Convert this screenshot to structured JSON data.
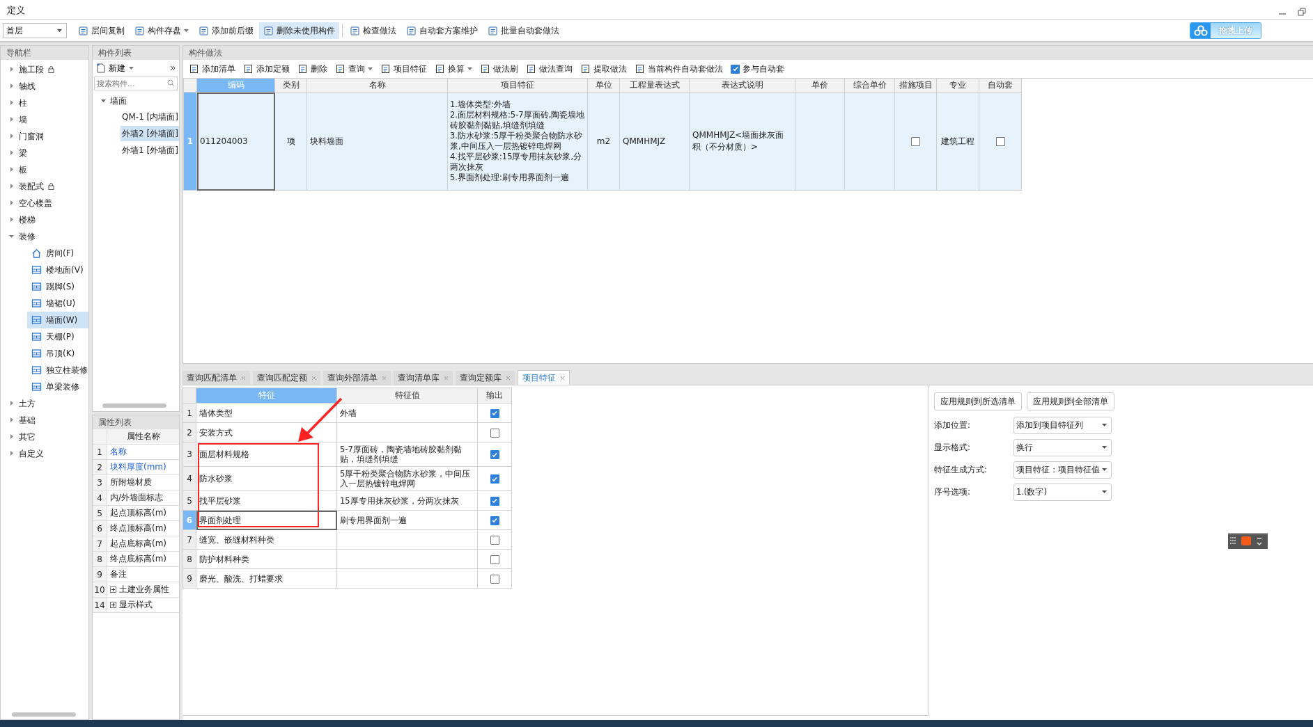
{
  "window": {
    "title": "定义"
  },
  "toolbar": {
    "floor_select": {
      "value": "首层"
    },
    "buttons": [
      {
        "label": "层间复制",
        "dropdown": false,
        "active": false
      },
      {
        "label": "构件存盘",
        "dropdown": true,
        "active": false
      },
      {
        "label": "添加前后缀",
        "dropdown": false,
        "active": false
      },
      {
        "label": "删除未使用构件",
        "dropdown": false,
        "active": true
      },
      {
        "label": "检查做法",
        "dropdown": false,
        "active": false
      },
      {
        "label": "自动套方案维护",
        "dropdown": false,
        "active": false
      },
      {
        "label": "批量自动套做法",
        "dropdown": false,
        "active": false
      }
    ],
    "upload_button": {
      "label": "拖拽上传"
    }
  },
  "nav": {
    "title": "导航栏",
    "items": [
      {
        "label": "施工段",
        "locked": true,
        "expanded": false
      },
      {
        "label": "轴线",
        "locked": false,
        "expanded": false
      },
      {
        "label": "柱",
        "locked": false,
        "expanded": false
      },
      {
        "label": "墙",
        "locked": false,
        "expanded": false
      },
      {
        "label": "门窗洞",
        "locked": false,
        "expanded": false
      },
      {
        "label": "梁",
        "locked": false,
        "expanded": false
      },
      {
        "label": "板",
        "locked": false,
        "expanded": false
      },
      {
        "label": "装配式",
        "locked": true,
        "expanded": false
      },
      {
        "label": "空心楼盖",
        "locked": false,
        "expanded": false
      },
      {
        "label": "楼梯",
        "locked": false,
        "expanded": false
      },
      {
        "label": "装修",
        "locked": false,
        "expanded": true,
        "children": [
          {
            "label": "房间(F)",
            "selected": false
          },
          {
            "label": "楼地面(V)",
            "selected": false
          },
          {
            "label": "踢脚(S)",
            "selected": false
          },
          {
            "label": "墙裙(U)",
            "selected": false
          },
          {
            "label": "墙面(W)",
            "selected": true
          },
          {
            "label": "天棚(P)",
            "selected": false
          },
          {
            "label": "吊顶(K)",
            "selected": false
          },
          {
            "label": "独立柱装修",
            "selected": false
          },
          {
            "label": "单梁装修",
            "selected": false
          }
        ]
      },
      {
        "label": "土方",
        "locked": false,
        "expanded": false
      },
      {
        "label": "基础",
        "locked": false,
        "expanded": false
      },
      {
        "label": "其它",
        "locked": false,
        "expanded": false
      },
      {
        "label": "自定义",
        "locked": false,
        "expanded": false
      }
    ]
  },
  "component_list": {
    "title": "构件列表",
    "new_button": "新建",
    "search": {
      "placeholder": "搜索构件..."
    },
    "tree": [
      {
        "label": "墙面",
        "expanded": true,
        "children": [
          {
            "label": "QM-1 [内墙面]",
            "selected": false
          },
          {
            "label": "外墙2 [外墙面]",
            "selected": true
          },
          {
            "label": "外墙1 [外墙面]",
            "selected": false
          }
        ]
      }
    ]
  },
  "properties": {
    "title": "属性列表",
    "column": "属性名称",
    "rows": [
      {
        "index": "1",
        "label": "名称",
        "public": true,
        "expandable": false
      },
      {
        "index": "2",
        "label": "块料厚度(mm)",
        "public": true,
        "expandable": false
      },
      {
        "index": "3",
        "label": "所附墙材质",
        "public": false,
        "expandable": false
      },
      {
        "index": "4",
        "label": "内/外墙面标志",
        "public": false,
        "expandable": false
      },
      {
        "index": "5",
        "label": "起点顶标高(m)",
        "public": false,
        "expandable": false
      },
      {
        "index": "6",
        "label": "终点顶标高(m)",
        "public": false,
        "expandable": false
      },
      {
        "index": "7",
        "label": "起点底标高(m)",
        "public": false,
        "expandable": false
      },
      {
        "index": "8",
        "label": "终点底标高(m)",
        "public": false,
        "expandable": false
      },
      {
        "index": "9",
        "label": "备注",
        "public": false,
        "expandable": false
      },
      {
        "index": "10",
        "label": "土建业务属性",
        "public": false,
        "expandable": true
      },
      {
        "index": "14",
        "label": "显示样式",
        "public": false,
        "expandable": true
      }
    ]
  },
  "methods": {
    "title": "构件做法",
    "toolbar": [
      {
        "kind": "button",
        "label": "添加清单",
        "dropdown": false
      },
      {
        "kind": "button",
        "label": "添加定额",
        "dropdown": false
      },
      {
        "kind": "button",
        "label": "删除",
        "dropdown": false
      },
      {
        "kind": "button",
        "label": "查询",
        "dropdown": true
      },
      {
        "kind": "button",
        "label": "项目特征",
        "dropdown": false
      },
      {
        "kind": "button",
        "label": "换算",
        "dropdown": true
      },
      {
        "kind": "button",
        "label": "做法刷",
        "dropdown": false
      },
      {
        "kind": "button",
        "label": "做法查询",
        "dropdown": false
      },
      {
        "kind": "button",
        "label": "提取做法",
        "dropdown": false
      },
      {
        "kind": "button",
        "label": "当前构件自动套做法",
        "dropdown": false
      },
      {
        "kind": "checkbox",
        "label": "参与自动套",
        "checked": true
      }
    ],
    "table": {
      "columns": [
        {
          "label": "编码",
          "selected": true
        },
        {
          "label": "类别",
          "selected": false
        },
        {
          "label": "名称",
          "selected": false
        },
        {
          "label": "项目特征",
          "selected": false
        },
        {
          "label": "单位",
          "selected": false
        },
        {
          "label": "工程量表达式",
          "selected": false
        },
        {
          "label": "表达式说明",
          "selected": false
        },
        {
          "label": "单价",
          "selected": false
        },
        {
          "label": "综合单价",
          "selected": false
        },
        {
          "label": "措施项目",
          "selected": false
        },
        {
          "label": "专业",
          "selected": false
        },
        {
          "label": "自动套",
          "selected": false
        }
      ],
      "rows": [
        {
          "index": "1",
          "selected": true,
          "code": "011204003",
          "type": "项",
          "name": "块料墙面",
          "features": [
            "1.墙体类型:外墙",
            "2.面层材料规格:5-7厚面砖,陶瓷墙地砖胶黏剂黏贴,填缝剂填缝",
            "3.防水砂浆:5厚干粉类聚合物防水砂浆,中间压入一层热镀锌电焊网",
            "4.找平层砂浆:15厚专用抹灰砂浆,分两次抹灰",
            "5.界面剂处理:刷专用界面剂一遍"
          ],
          "unit": "m2",
          "expression": "QMMHMJZ",
          "expression_note": "QMMHMJZ<墙面抹灰面积（不分材质）>",
          "measure_item": false,
          "discipline": "建筑工程",
          "auto": false
        }
      ]
    }
  },
  "bottom_tabs": [
    {
      "label": "查询匹配清单",
      "selected": false
    },
    {
      "label": "查询匹配定额",
      "selected": false
    },
    {
      "label": "查询外部清单",
      "selected": false
    },
    {
      "label": "查询清单库",
      "selected": false
    },
    {
      "label": "查询定额库",
      "selected": false
    },
    {
      "label": "项目特征",
      "selected": true
    }
  ],
  "feature_table": {
    "columns": [
      "特征",
      "特征值",
      "输出"
    ],
    "rows": [
      {
        "index": "1",
        "feature": "墙体类型",
        "value": "外墙",
        "output": true,
        "selected": false
      },
      {
        "index": "2",
        "feature": "安装方式",
        "output": false,
        "selected": false
      },
      {
        "index": "3",
        "feature": "面层材料规格",
        "value": "5-7厚面砖，陶瓷墙地砖胶黏剂黏贴，填缝剂填缝",
        "output": true,
        "selected": false
      },
      {
        "index": "4",
        "feature": "防水砂浆",
        "value": "5厚干粉类聚合物防水砂浆，中间压入一层热镀锌电焊网",
        "output": true,
        "selected": false
      },
      {
        "index": "5",
        "feature": "找平层砂浆",
        "value": "15厚专用抹灰砂浆，分两次抹灰",
        "output": true,
        "selected": false
      },
      {
        "index": "6",
        "feature": "界面剂处理",
        "value": "刷专用界面剂一遍",
        "output": true,
        "selected": true
      },
      {
        "index": "7",
        "feature": "缝宽、嵌缝材料种类",
        "output": false,
        "selected": false
      },
      {
        "index": "8",
        "feature": "防护材料种类",
        "output": false,
        "selected": false
      },
      {
        "index": "9",
        "feature": "磨光、酸洗、打蜡要求",
        "output": false,
        "selected": false
      }
    ]
  },
  "rules_panel": {
    "buttons": [
      "应用规则到所选清单",
      "应用规则到全部清单"
    ],
    "settings": [
      {
        "label": "添加位置:",
        "value": "添加到项目特征列"
      },
      {
        "label": "显示格式:",
        "value": "换行"
      },
      {
        "label": "特征生成方式:",
        "value": "项目特征：项目特征值"
      },
      {
        "label": "序号选项:",
        "value": "1.(数字)"
      }
    ]
  }
}
